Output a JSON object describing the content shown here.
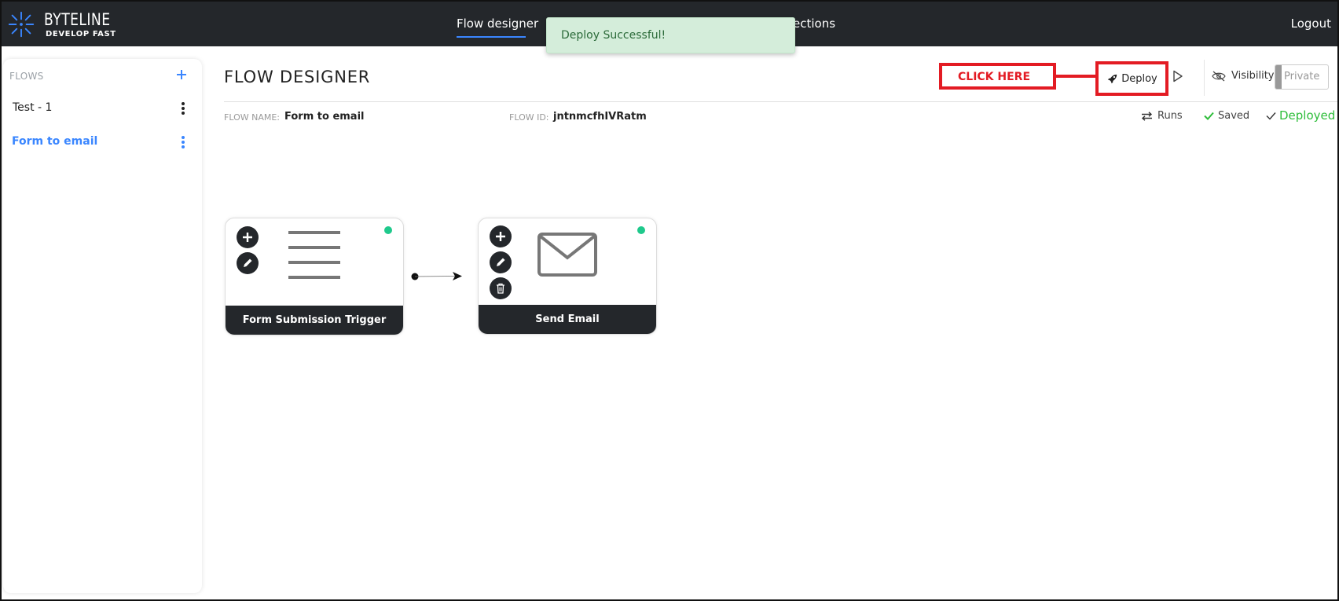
{
  "app": {
    "brand_name": "BYTELINE",
    "brand_tagline": "DEVELOP FAST",
    "accent_color": "#3a86ff"
  },
  "nav": {
    "flow_designer": "Flow designer",
    "connections_partial": "ections",
    "logout": "Logout"
  },
  "toast": {
    "message": "Deploy Successful!"
  },
  "sidebar": {
    "heading": "FLOWS",
    "add_icon": "plus-icon",
    "flows": [
      {
        "label": "Test - 1",
        "active": false
      },
      {
        "label": "Form to email",
        "active": true
      }
    ]
  },
  "header": {
    "title": "FLOW DESIGNER",
    "annotation": "CLICK HERE",
    "deploy_label": "Deploy",
    "visibility_label": "Visibility",
    "private_label": "Private"
  },
  "meta": {
    "flow_name_label": "FLOW NAME:",
    "flow_name_value": "Form to email",
    "flow_id_label": "FLOW ID:",
    "flow_id_value": "jntnmcfhIVRatm",
    "runs_label": "Runs",
    "saved_label": "Saved",
    "deployed_label": "Deployed"
  },
  "nodes": [
    {
      "title": "Form Submission Trigger",
      "icon": "form-lines-icon",
      "status_color": "#1fc98c"
    },
    {
      "title": "Send Email",
      "icon": "envelope-icon",
      "status_color": "#1fc98c"
    }
  ]
}
